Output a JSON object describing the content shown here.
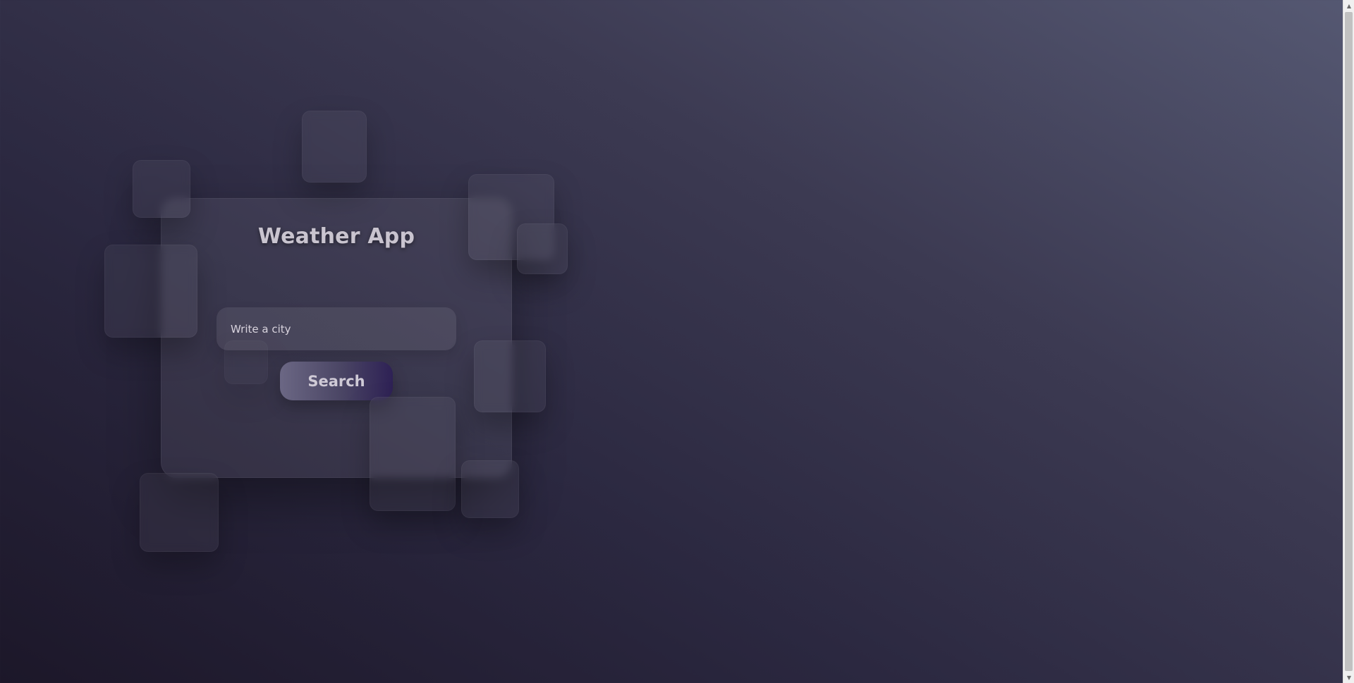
{
  "app": {
    "title": "Weather App"
  },
  "search": {
    "placeholder": "Write a city",
    "value": "",
    "button_label": "Search"
  },
  "scrollbar": {
    "up_arrow_icon": "triangle-up-icon",
    "down_arrow_icon": "triangle-down-icon",
    "up_glyph": "▲",
    "down_glyph": "▼"
  },
  "colors": {
    "background_dark": "#1c1729",
    "background_light": "#555872",
    "button_gradient_start": "#6b6784",
    "button_gradient_end": "#2e2155",
    "title_text": "#c9c4cf"
  }
}
